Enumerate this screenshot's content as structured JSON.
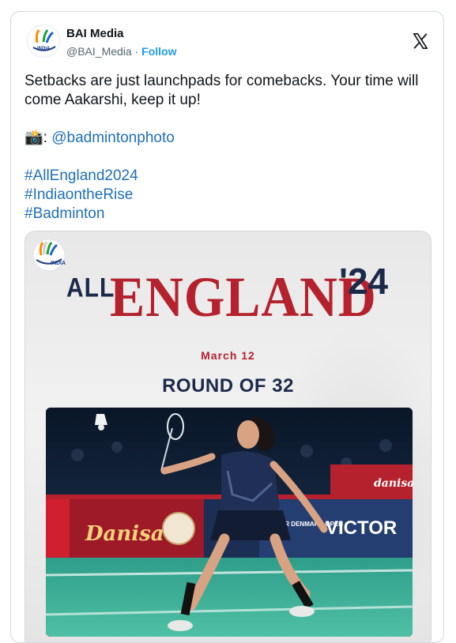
{
  "author": {
    "display_name": "BAI Media",
    "handle": "@BAI_Media",
    "separator": "·",
    "follow_label": "Follow",
    "avatar_text": "INDIA"
  },
  "tweet": {
    "line1": "Setbacks are just launchpads for comebacks. Your time will come Aakarshi, keep it up!",
    "camera_emoji": "📸",
    "credit_sep": ":",
    "credit_link": "@badmintonphoto",
    "hashtags": [
      "#AllEngland2024",
      "#IndiaontheRise",
      "#Badminton"
    ]
  },
  "media": {
    "logo_text": "INDIA",
    "title_all": "ALL",
    "title_england": "ENGLAND",
    "title_year": "'24",
    "date": "March 12",
    "round": "ROUND OF 32",
    "sponsors": [
      "Danisa",
      "VICTOR",
      "VICTOR DENMARK OPEN",
      "danisa"
    ]
  },
  "colors": {
    "link": "#1d6fb8",
    "follow": "#1d9bf0",
    "brand_red": "#b5212d",
    "brand_navy": "#1b2a4a"
  },
  "icons": [
    "x-logo-icon",
    "camera-icon"
  ]
}
